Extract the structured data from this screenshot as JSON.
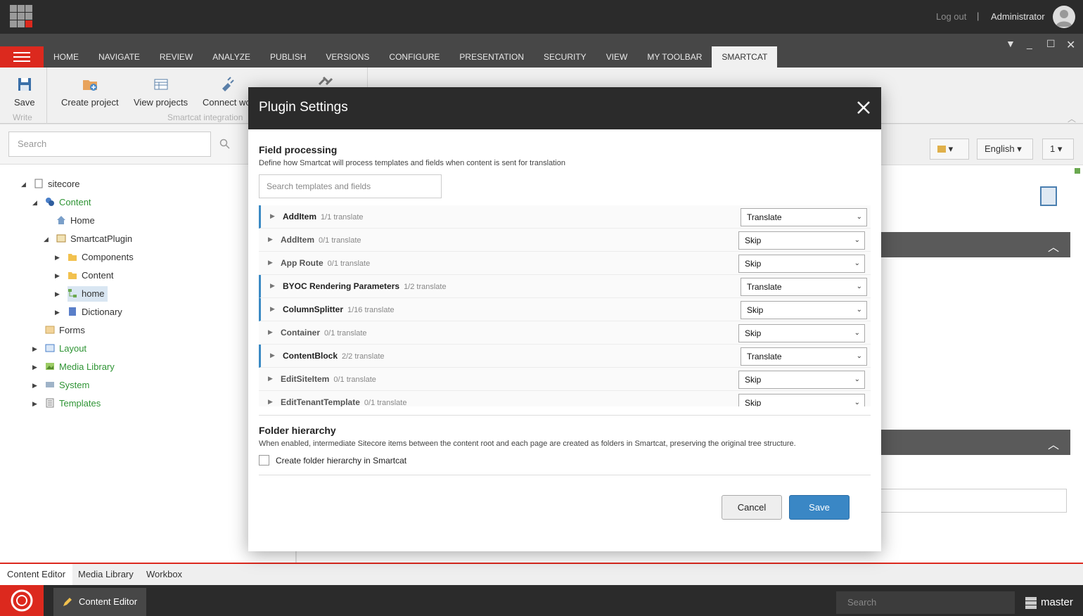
{
  "topbar": {
    "logout": "Log out",
    "separator": "|",
    "user": "Administrator"
  },
  "ribbon": {
    "tabs": [
      "HOME",
      "NAVIGATE",
      "REVIEW",
      "ANALYZE",
      "PUBLISH",
      "VERSIONS",
      "CONFIGURE",
      "PRESENTATION",
      "SECURITY",
      "VIEW",
      "MY TOOLBAR",
      "SMARTCAT"
    ],
    "active_tab": "SMARTCAT",
    "save_label": "Save",
    "write_group": "Write",
    "create_project": "Create project",
    "view_projects": "View projects",
    "connect": "Connect wo",
    "smartcat_group": "Smartcat integration"
  },
  "left": {
    "search_placeholder": "Search",
    "tree": {
      "sitecore": "sitecore",
      "content": "Content",
      "home": "Home",
      "plugin": "SmartcatPlugin",
      "components": "Components",
      "content2": "Content",
      "home2": "home",
      "dictionary": "Dictionary",
      "forms": "Forms",
      "layout": "Layout",
      "media": "Media Library",
      "system": "System",
      "templates": "Templates"
    }
  },
  "right": {
    "language": "English",
    "version": "1"
  },
  "modal": {
    "title": "Plugin Settings",
    "field_processing_title": "Field processing",
    "field_processing_desc": "Define how Smartcat will process templates and fields when content is sent for translation",
    "search_placeholder": "Search templates and fields",
    "rows": [
      {
        "name": "AddItem",
        "count": "1/1 translate",
        "action": "Translate"
      },
      {
        "name": "AddItem",
        "count": "0/1 translate",
        "action": "Skip"
      },
      {
        "name": "App Route",
        "count": "0/1 translate",
        "action": "Skip"
      },
      {
        "name": "BYOC Rendering Parameters",
        "count": "1/2 translate",
        "action": "Translate"
      },
      {
        "name": "ColumnSplitter",
        "count": "1/16 translate",
        "action": "Skip"
      },
      {
        "name": "Container",
        "count": "0/1 translate",
        "action": "Skip"
      },
      {
        "name": "ContentBlock",
        "count": "2/2 translate",
        "action": "Translate"
      },
      {
        "name": "EditSiteItem",
        "count": "0/1 translate",
        "action": "Skip"
      },
      {
        "name": "EditTenantTemplate",
        "count": "0/1 translate",
        "action": "Skip"
      }
    ],
    "folder_title": "Folder hierarchy",
    "folder_desc": "When enabled, intermediate Sitecore items between the content root and each page are created as folders in Smartcat, preserving the original tree structure.",
    "folder_checkbox": "Create folder hierarchy in Smartcat",
    "cancel": "Cancel",
    "save": "Save"
  },
  "bottom": {
    "tabs": [
      "Content Editor",
      "Media Library",
      "Workbox"
    ],
    "task": "Content Editor",
    "search_placeholder": "Search",
    "database": "master"
  },
  "colors": {
    "accent_red": "#dc291e",
    "primary_blue": "#3a87c5",
    "dark": "#2b2b2b"
  }
}
